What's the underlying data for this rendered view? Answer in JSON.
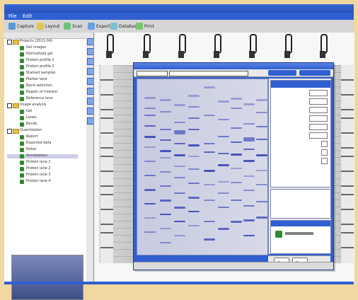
{
  "app": {
    "title": "",
    "menu": [
      "File",
      "Edit"
    ]
  },
  "toolbar": {
    "buttons": [
      {
        "label": "Capture",
        "icon": "camera-icon"
      },
      {
        "label": "Layout",
        "icon": "layout-icon"
      },
      {
        "label": "Scan",
        "icon": "scan-icon"
      },
      {
        "label": "Export",
        "icon": "export-icon"
      },
      {
        "label": "Database",
        "icon": "database-icon"
      },
      {
        "label": "Print",
        "icon": "printer-icon"
      }
    ]
  },
  "sidebar": {
    "tree": [
      {
        "label": "Projects (2011-04)",
        "type": "folder"
      },
      {
        "label": "Gel images",
        "type": "leaf"
      },
      {
        "label": "Normalized gel",
        "type": "leaf"
      },
      {
        "label": "Protein profile 1",
        "type": "leaf"
      },
      {
        "label": "Protein profile 2",
        "type": "leaf"
      },
      {
        "label": "Stained samples",
        "type": "leaf"
      },
      {
        "label": "Marker lane",
        "type": "leaf"
      },
      {
        "label": "Band selection",
        "type": "leaf"
      },
      {
        "label": "Region of interest",
        "type": "leaf"
      },
      {
        "label": "Reference lane",
        "type": "leaf"
      },
      {
        "label": "Image analysis",
        "type": "folder"
      },
      {
        "label": "Gel",
        "type": "leaf"
      },
      {
        "label": "Lanes",
        "type": "leaf"
      },
      {
        "label": "Bands",
        "type": "leaf"
      },
      {
        "label": "Quantitation",
        "type": "folder"
      },
      {
        "label": "Report",
        "type": "leaf"
      },
      {
        "label": "Exported data",
        "type": "leaf"
      },
      {
        "label": "Notes",
        "type": "leaf"
      },
      {
        "label": "Annotations",
        "type": "leaf"
      },
      {
        "label": "Protein lane 1",
        "type": "leaf"
      },
      {
        "label": "Protein lane 2",
        "type": "leaf"
      },
      {
        "label": "Protein lane 3",
        "type": "leaf"
      },
      {
        "label": "Protein lane 4",
        "type": "leaf"
      }
    ]
  },
  "dialog": {
    "title": "",
    "tabs": [
      "",
      ""
    ],
    "panel": {
      "title": "",
      "rows": [
        {
          "label": "",
          "value": ""
        },
        {
          "label": "",
          "value": ""
        },
        {
          "label": "",
          "value": ""
        },
        {
          "label": "",
          "value": ""
        },
        {
          "label": "",
          "value": ""
        },
        {
          "label": "",
          "value": ""
        },
        {
          "label": "",
          "value": ""
        },
        {
          "label": "",
          "value": ""
        },
        {
          "label": "",
          "value": ""
        }
      ]
    },
    "objects_title": "",
    "footer_buttons": [
      "Print",
      "Close"
    ],
    "status_left": "",
    "status_mid": ""
  },
  "colors": {
    "accent": "#2f5fd0",
    "tan_background": "#f1d7a0",
    "band_blue": "#2d3ab2"
  }
}
